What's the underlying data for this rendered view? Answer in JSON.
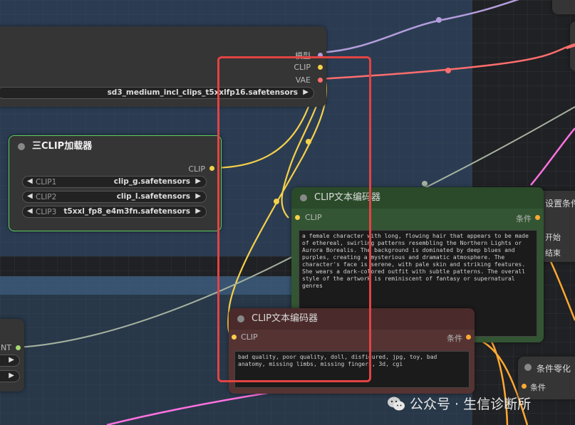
{
  "nodes": {
    "checkpoint_loader": {
      "outputs": [
        "模型",
        "CLIP",
        "VAE"
      ],
      "ckpt_value": "sd3_medium_incl_clips_t5xxlfp16.safetensors"
    },
    "triple_clip_loader": {
      "title": "三CLIP加载器",
      "output": "CLIP",
      "widgets": [
        {
          "label": "CLIP1",
          "value": "clip_g.safetensors"
        },
        {
          "label": "CLIP2",
          "value": "clip_l.safetensors"
        },
        {
          "label": "CLIP3",
          "value": "t5xxl_fp8_e4m3fn.safetensors"
        }
      ]
    },
    "clip_text_encode_positive": {
      "title": "CLIP文本编码器",
      "input": "CLIP",
      "output": "条件",
      "text": "a female character with long, flowing hair that appears to be made of ethereal, swirling patterns resembling the Northern Lights or Aurora Borealis. The background is dominated by deep blues and purples, creating a mysterious and dramatic atmosphere. The character's face is serene, with pale skin and striking features. She wears a dark-colored outfit with subtle patterns. The overall style of the artwork is reminiscent of fantasy or supernatural genres"
    },
    "clip_text_encode_negative": {
      "title": "CLIP文本编码器",
      "input": "CLIP",
      "output": "条件",
      "text": "bad quality, poor quality, doll, disfigured, jpg, toy, bad anatomy, missing limbs, missing fingers, 3d, cgi"
    },
    "conditioning_set_timestep": {
      "title": "设置条件",
      "rows": [
        "开始",
        "结束"
      ]
    },
    "conditioning_zero_out": {
      "title": "条件零化",
      "input": "条件"
    },
    "left_node": {
      "output": "INT"
    }
  },
  "watermark": {
    "text": "公众号 · 生信诊断所"
  },
  "colors": {
    "clip_wire": "#f5d04a",
    "vae_wire": "#ff6e6e",
    "model_wire": "#b39ddb",
    "cond_wire": "#ffa931",
    "int_wire": "#a6b3a0",
    "highlight": "#e34343"
  }
}
